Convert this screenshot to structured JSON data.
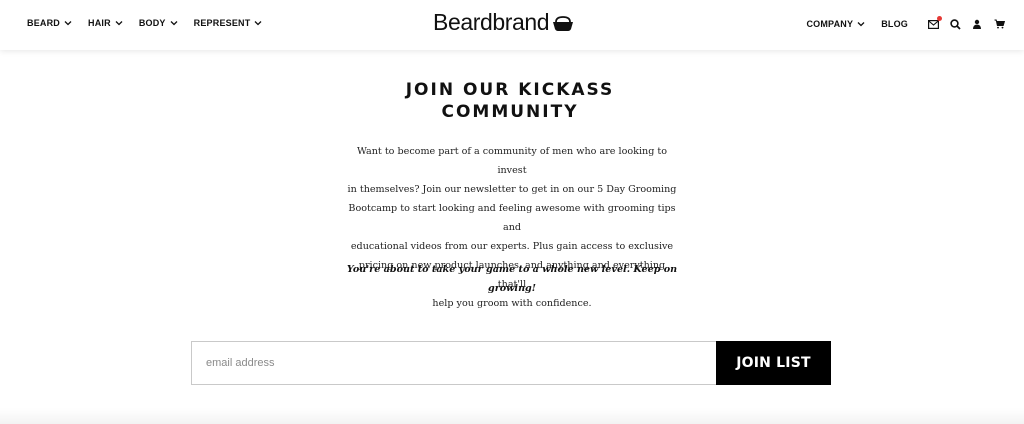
{
  "header": {
    "nav_left": [
      {
        "label": "BEARD"
      },
      {
        "label": "HAIR"
      },
      {
        "label": "BODY"
      },
      {
        "label": "REPRESENT"
      }
    ],
    "logo": "Beardbrand",
    "nav_right": [
      {
        "label": "COMPANY",
        "has_dropdown": true
      },
      {
        "label": "BLOG",
        "has_dropdown": false
      }
    ],
    "icons": [
      "mail-icon",
      "search-icon",
      "account-icon",
      "cart-icon"
    ],
    "notification_color": "#e53935"
  },
  "main": {
    "title_line1": "JOIN OUR KICKASS",
    "title_line2": "COMMUNITY",
    "paragraph_lines": [
      "Want to become part of a community of men who are looking to invest",
      "in themselves? Join our newsletter to get in on our 5 Day Grooming",
      "Bootcamp to start looking and feeling awesome with grooming tips and",
      "educational videos from our experts. Plus gain access to exclusive",
      "pricing on new product launches, and anything and everything that'll",
      "help you groom with confidence."
    ],
    "tagline_line1": "You're about to take your game to a whole new level. Keep on",
    "tagline_line2": "growing!"
  },
  "signup": {
    "email_placeholder": "email address",
    "email_value": "",
    "button_label": "JOIN LIST"
  }
}
